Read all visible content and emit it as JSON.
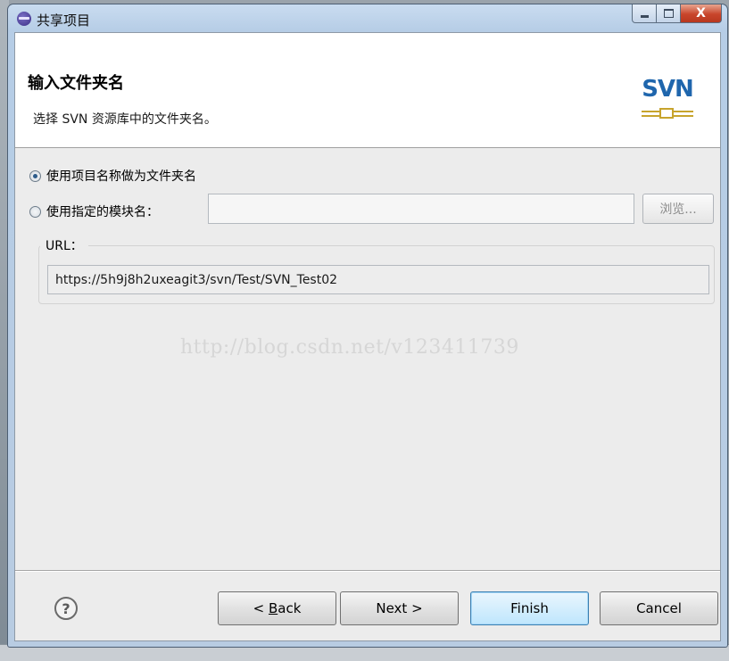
{
  "window": {
    "title": "共享项目",
    "close_glyph": "X"
  },
  "header": {
    "title": "输入文件夹名",
    "description": "选择 SVN 资源库中的文件夹名。",
    "logo_text": "SVN",
    "logo_icon": "svn-logo-icon"
  },
  "options": {
    "use_project_name_label": "使用项目名称做为文件夹名",
    "use_module_name_label": "使用指定的模块名：",
    "selected": "use_project_name",
    "module_name_value": "",
    "browse_label": "浏览..."
  },
  "url_group": {
    "label": "URL：",
    "value": "https://5h9j8h2uxeagit3/svn/Test/SVN_Test02"
  },
  "watermark": "http://blog.csdn.net/v123411739",
  "footer": {
    "help_glyph": "?",
    "back_label_prefix": "< ",
    "back_label_mnemonic": "B",
    "back_label_rest": "ack",
    "next_label": "Next >",
    "finish_label": "Finish",
    "cancel_label": "Cancel"
  }
}
